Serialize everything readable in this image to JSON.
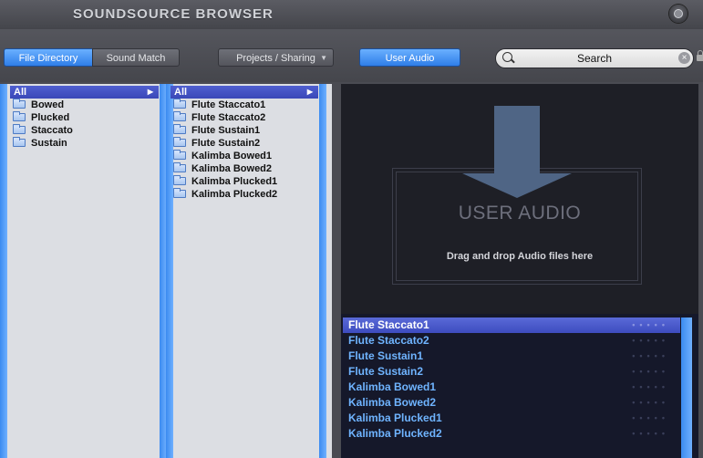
{
  "app": {
    "title": "SOUNDSOURCE BROWSER"
  },
  "toolbar": {
    "file_directory": "File Directory",
    "sound_match": "Sound Match",
    "projects_sharing": "Projects / Sharing",
    "user_audio": "User Audio",
    "search_value": "Search"
  },
  "left_list": {
    "header": "All",
    "items": [
      "Bowed",
      "Plucked",
      "Staccato",
      "Sustain"
    ]
  },
  "middle_list": {
    "header": "All",
    "items": [
      "Flute Staccato1",
      "Flute Staccato2",
      "Flute Sustain1",
      "Flute Sustain2",
      "Kalimba Bowed1",
      "Kalimba Bowed2",
      "Kalimba Plucked1",
      "Kalimba Plucked2"
    ]
  },
  "drop_zone": {
    "title": "USER AUDIO",
    "hint": "Drag and drop Audio files here"
  },
  "audio_list": {
    "selected_index": 0,
    "items": [
      "Flute Staccato1",
      "Flute Staccato2",
      "Flute Sustain1",
      "Flute Sustain2",
      "Kalimba Bowed1",
      "Kalimba Bowed2",
      "Kalimba Plucked1",
      "Kalimba Plucked2"
    ]
  },
  "colors": {
    "accent": "#2f7ee8",
    "selection": "#3d4cbf",
    "list_text": "#6fb4ff"
  },
  "icons": [
    "power-icon",
    "search-icon",
    "clear-icon",
    "lock-icon",
    "folder-icon",
    "dropdown-caret-icon",
    "arrow-down-icon"
  ]
}
